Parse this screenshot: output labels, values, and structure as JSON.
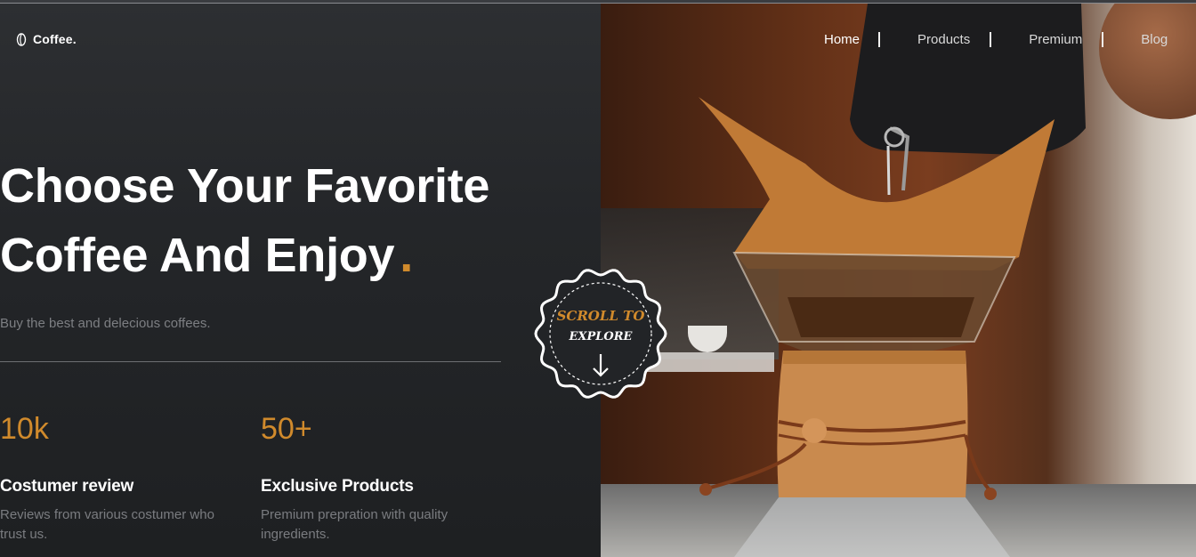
{
  "nav": {
    "logo_text": "Coffee.",
    "links": [
      {
        "label": "Home"
      },
      {
        "label": "Products"
      },
      {
        "label": "Premium"
      },
      {
        "label": "Blog"
      }
    ]
  },
  "hero": {
    "headline_line1": "Choose Your Favorite",
    "headline_line2": "Coffee And Enjoy",
    "headline_dot": ".",
    "subtitle": "Buy the best and delecious coffees."
  },
  "stats": [
    {
      "value": "10k",
      "label": "Costumer review",
      "description": "Reviews from various costumer who trust us."
    },
    {
      "value": "50+",
      "label": "Exclusive Products",
      "description": "Premium prepration with quality ingredients."
    }
  ],
  "scroll_badge": {
    "line1": "SCROLL TO",
    "line2": "EXPLORE",
    "icon": "arrow-down-icon"
  },
  "colors": {
    "accent": "#d08a2c",
    "background": "#1f2123",
    "text": "#ffffff",
    "muted": "#7d7f83"
  },
  "icons": {
    "logo": "coffee-bean-icon"
  }
}
